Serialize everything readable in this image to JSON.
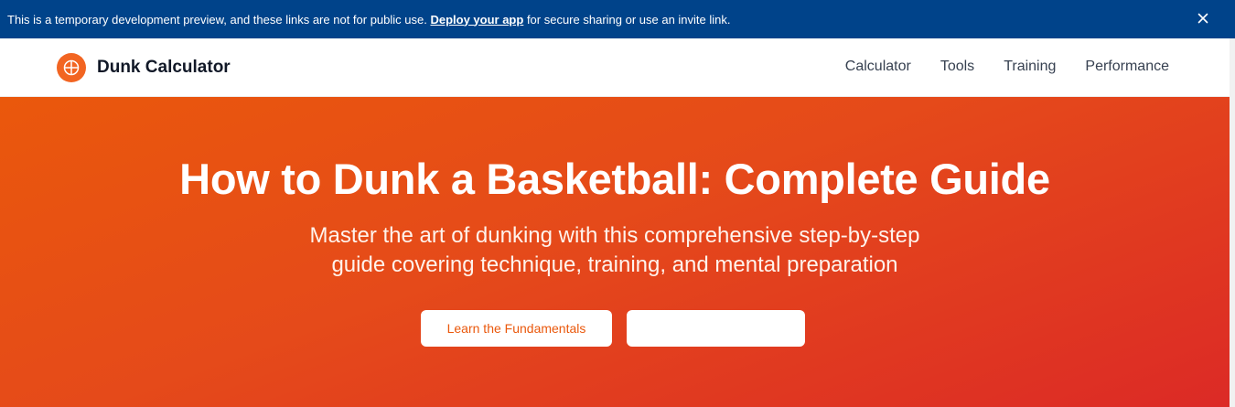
{
  "banner": {
    "text_before": "This is a temporary development preview, and these links are not for public use. ",
    "link_text": "Deploy your app",
    "text_after": " for secure sharing or use an invite link.",
    "close_icon": "close-icon",
    "background": "#00438a"
  },
  "navbar": {
    "brand_name": "Dunk Calculator",
    "logo_icon": "basketball-icon",
    "links": [
      "Calculator",
      "Tools",
      "Training",
      "Performance"
    ]
  },
  "hero": {
    "title": "How to Dunk a Basketball: Complete Guide",
    "subtitle_line1": "Master the art of dunking with this comprehensive step-by-step",
    "subtitle_line2": "guide covering technique, training, and mental preparation",
    "primary_button": "Learn the Fundamentals",
    "secondary_button": "",
    "gradient_start": "#ea580c",
    "gradient_end": "#dc2a26"
  },
  "colors": {
    "accent": "#f26522",
    "nav_text": "#374151"
  }
}
